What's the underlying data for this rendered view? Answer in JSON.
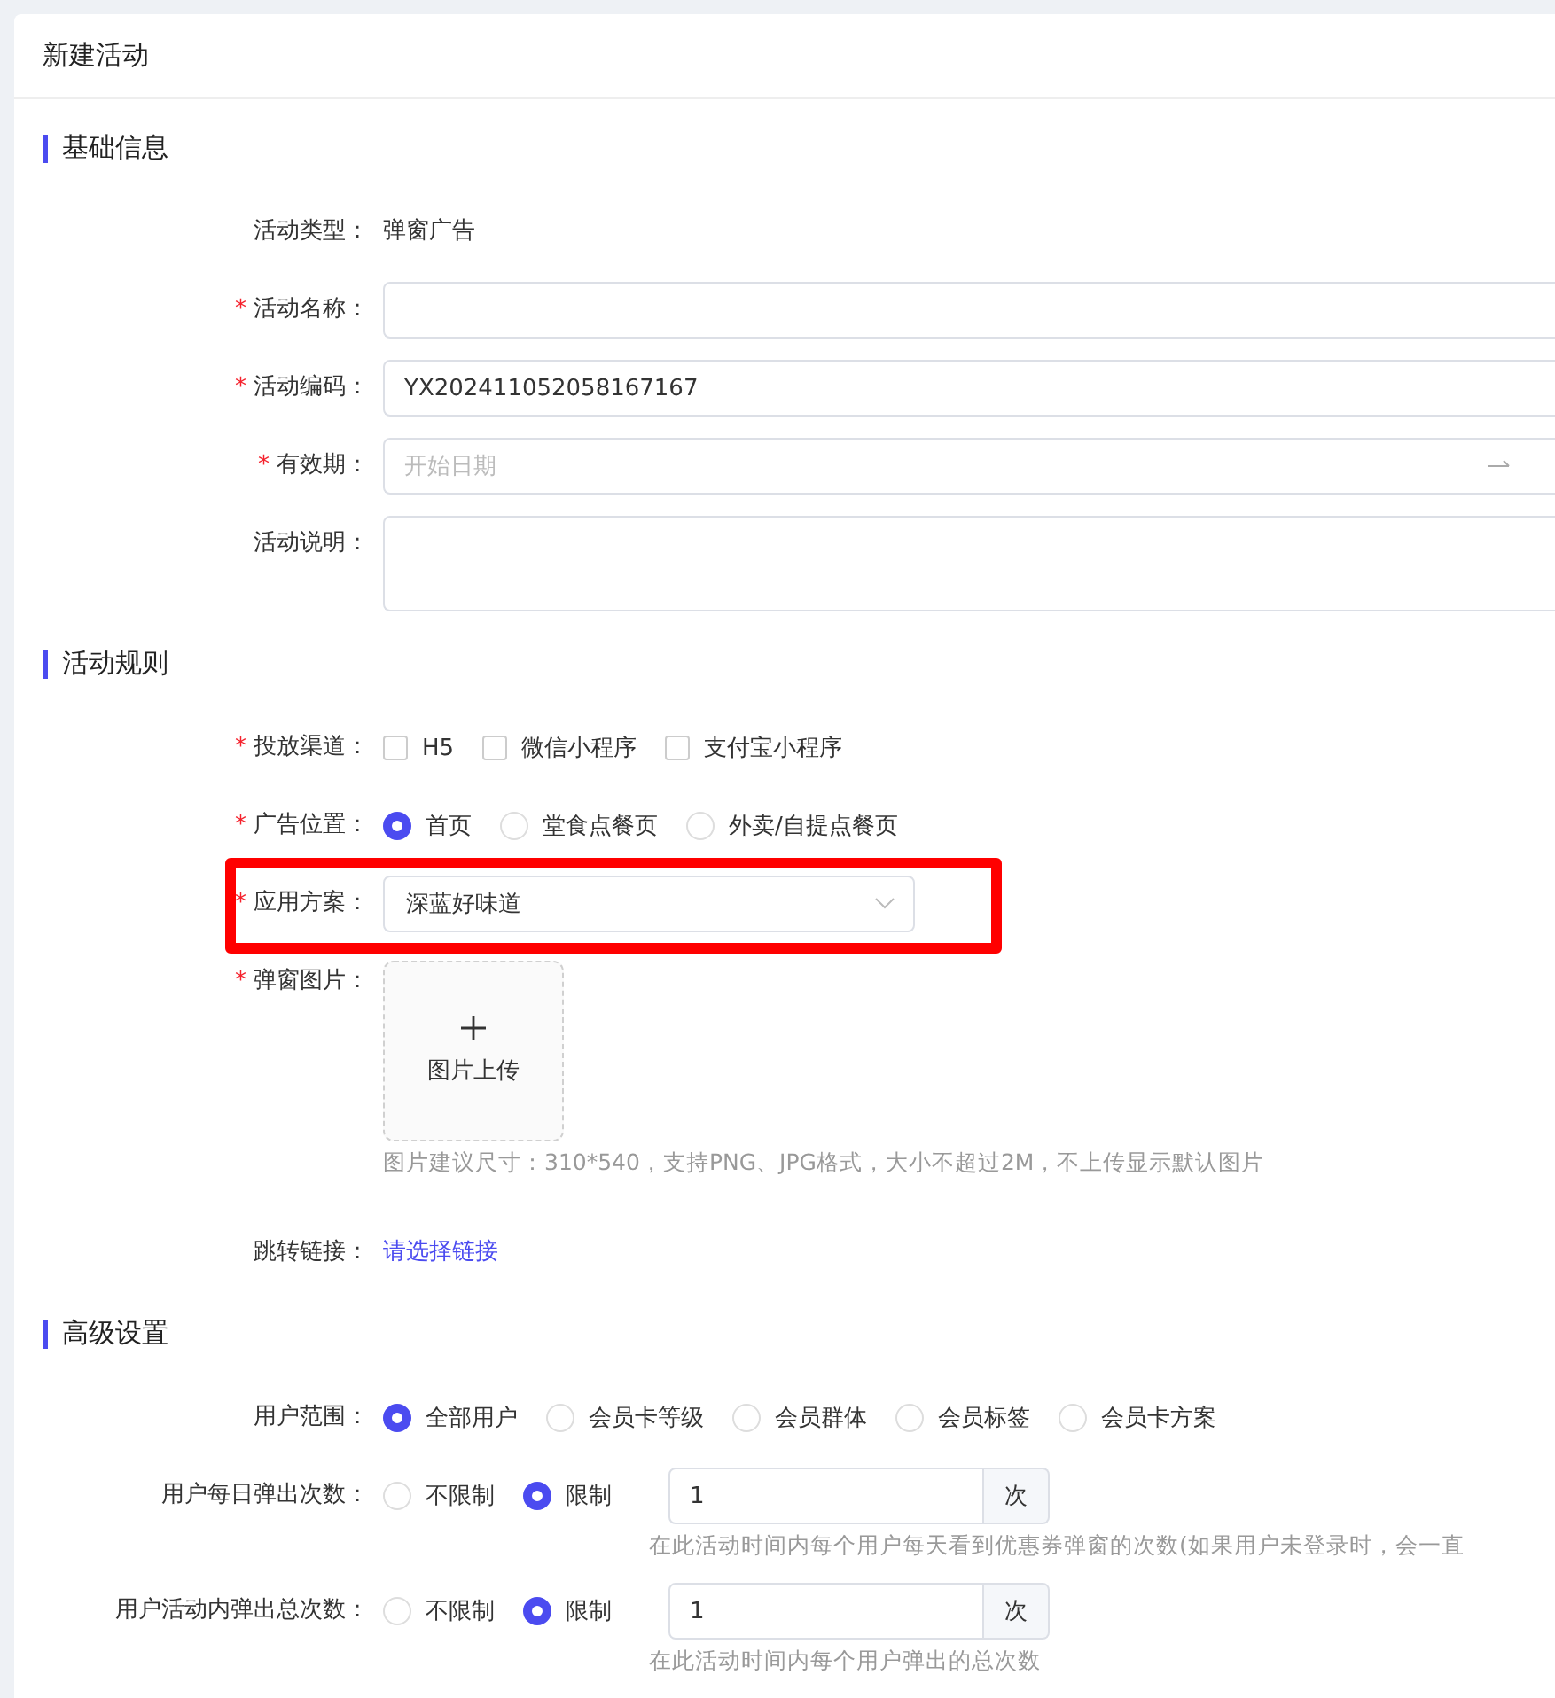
{
  "title": "新建活动",
  "sections": [
    {
      "title": "基础信息",
      "fields": [
        {
          "kind": "text",
          "label": "活动类型：",
          "value": "弹窗广告"
        },
        {
          "kind": "input",
          "label": "活动名称：",
          "mark": "*"
        },
        {
          "kind": "input",
          "label": "活动编码：",
          "mark": "*",
          "value": "YX202411052058167167"
        },
        {
          "kind": "daterange",
          "label": "有效期：",
          "mark": "*",
          "placeholder": "开始日期"
        },
        {
          "kind": "textarea",
          "label": "活动说明："
        }
      ]
    },
    {
      "title": "活动规则",
      "fields": [
        {
          "kind": "checkboxes",
          "label": "投放渠道：",
          "mark": "*",
          "options": [
            {
              "label": "H5",
              "checked": false
            },
            {
              "label": "微信小程序",
              "checked": false
            },
            {
              "label": "支付宝小程序",
              "checked": false
            }
          ]
        },
        {
          "kind": "radios",
          "label": "广告位置：",
          "mark": "*",
          "options": [
            {
              "label": "首页",
              "selected": true
            },
            {
              "label": "堂食点餐页",
              "selected": false
            },
            {
              "label": "外卖/自提点餐页",
              "selected": false
            }
          ]
        },
        {
          "kind": "select",
          "label": "应用方案：",
          "mark": "*",
          "value": "深蓝好味道",
          "highlighted": true
        },
        {
          "kind": "upload",
          "label": "弹窗图片：",
          "mark": "*",
          "button": "图片上传",
          "hint": "图片建议尺寸：310*540，支持PNG、JPG格式，大小不超过2M，不上传显示默认图片"
        },
        {
          "kind": "link",
          "label": "跳转链接：",
          "value": "请选择链接"
        }
      ]
    },
    {
      "title": "高级设置",
      "fields": [
        {
          "kind": "radios",
          "label": "用户范围：",
          "options": [
            {
              "label": "全部用户",
              "selected": true
            },
            {
              "label": "会员卡等级",
              "selected": false
            },
            {
              "label": "会员群体",
              "selected": false
            },
            {
              "label": "会员标签",
              "selected": false
            },
            {
              "label": "会员卡方案",
              "selected": false
            }
          ]
        },
        {
          "kind": "limit",
          "label": "用户每日弹出次数：",
          "options": [
            {
              "label": "不限制",
              "selected": false
            },
            {
              "label": "限制",
              "selected": true
            }
          ],
          "value": "1",
          "unit": "次",
          "hint": "在此活动时间内每个用户每天看到优惠券弹窗的次数(如果用户未登录时，会一直"
        },
        {
          "kind": "limit",
          "label": "用户活动内弹出总次数：",
          "options": [
            {
              "label": "不限制",
              "selected": false
            },
            {
              "label": "限制",
              "selected": true
            }
          ],
          "value": "1",
          "unit": "次",
          "hint": "在此活动时间内每个用户弹出的总次数"
        }
      ]
    }
  ]
}
